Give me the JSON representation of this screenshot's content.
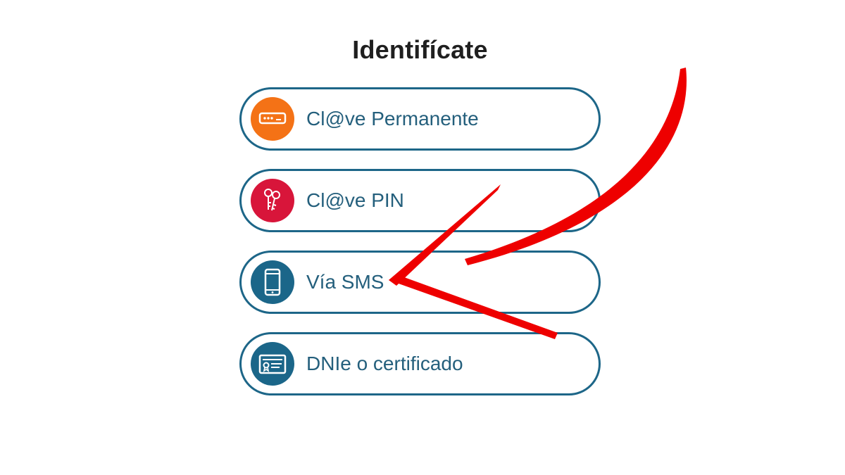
{
  "page": {
    "title": "Identifícate"
  },
  "options": [
    {
      "label": "Cl@ve Permanente",
      "icon": "password-field-icon",
      "color": "#f47216"
    },
    {
      "label": "Cl@ve PIN",
      "icon": "keys-icon",
      "color": "#d8153a"
    },
    {
      "label": "Vía SMS",
      "icon": "smartphone-icon",
      "color": "#1b6689"
    },
    {
      "label": "DNIe o certificado",
      "icon": "certificate-card-icon",
      "color": "#1b6689"
    }
  ],
  "annotation": {
    "arrow_color": "#ee0000",
    "arrow_target": "Vía SMS"
  }
}
